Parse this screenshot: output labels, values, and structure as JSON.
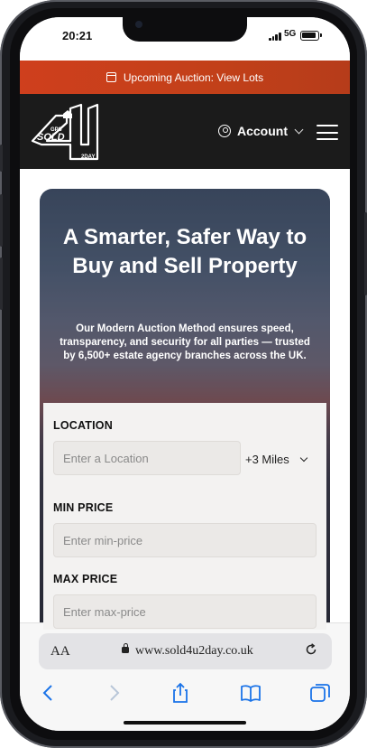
{
  "status_bar": {
    "time": "20:21",
    "network": "5G"
  },
  "announcement": {
    "text": "Upcoming Auction: View Lots"
  },
  "nav": {
    "logo": {
      "line1": "GPS",
      "line2": "SOLD",
      "line3": "2DAY",
      "mark": "4U"
    },
    "account_label": "Account"
  },
  "hero": {
    "title": "A Smarter, Safer Way to Buy and Sell Property",
    "subtitle": "Our Modern Auction Method ensures speed, transparency, and security for all parties — trusted by 6,500+ estate agency branches across the UK."
  },
  "search_form": {
    "location_label": "LOCATION",
    "location_placeholder": "Enter a Location",
    "radius_value": "+3 Miles",
    "min_price_label": "MIN PRICE",
    "min_price_placeholder": "Enter min-price",
    "max_price_label": "MAX PRICE",
    "max_price_placeholder": "Enter max-price"
  },
  "browser": {
    "text_size_label": "AA",
    "url": "www.sold4u2day.co.uk"
  },
  "colors": {
    "accent": "#c8421b",
    "nav_bg": "#1b1b1b",
    "form_bg": "#f3f2f1"
  }
}
